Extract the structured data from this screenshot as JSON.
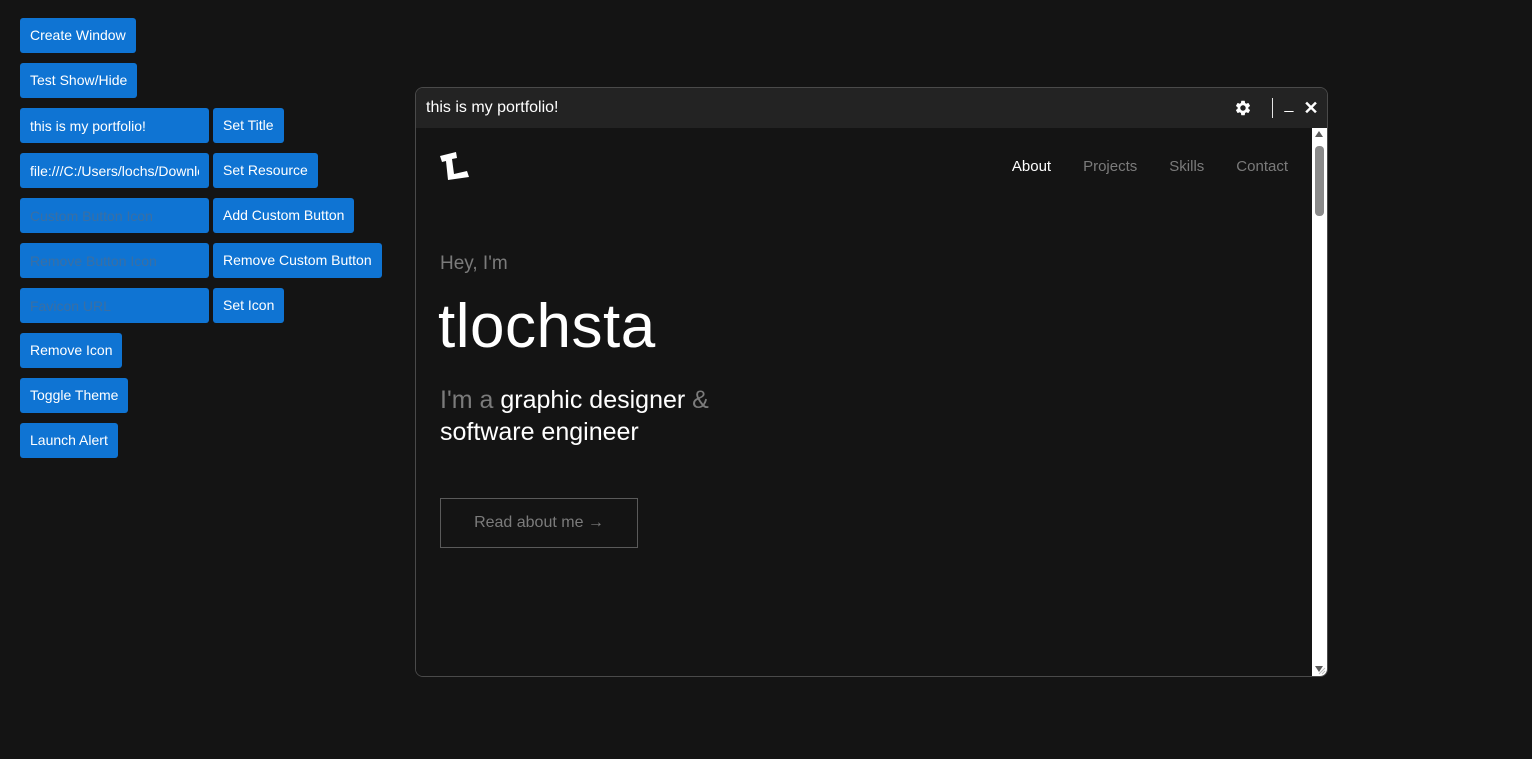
{
  "controls": {
    "create_window": "Create Window",
    "test_show_hide": "Test Show/Hide",
    "title_input_value": "this is my portfolio!",
    "set_title": "Set Title",
    "resource_input_value": "file:///C:/Users/lochs/Downloa",
    "set_resource": "Set Resource",
    "custom_button_icon_placeholder": "Custom Button Icon",
    "add_custom_button": "Add Custom Button",
    "remove_button_icon_placeholder": "Remove Button Icon",
    "remove_custom_button": "Remove Custom Button",
    "favicon_url_placeholder": "Favicon URL",
    "set_icon": "Set Icon",
    "remove_icon": "Remove Icon",
    "toggle_theme": "Toggle Theme",
    "launch_alert": "Launch Alert"
  },
  "window": {
    "title": "this is my portfolio!",
    "minimize_glyph": "_",
    "close_glyph": "✕",
    "icons": [
      "gear-icon",
      "minimize-icon",
      "close-icon"
    ]
  },
  "portfolio": {
    "nav": [
      "About",
      "Projects",
      "Skills",
      "Contact"
    ],
    "active_nav": "About",
    "greeting": "Hey, I'm",
    "name": "tlochsta",
    "tagline_prefix": "I'm a",
    "tagline_role1": "graphic designer",
    "tagline_amp": "&",
    "tagline_role2": "software engineer",
    "cta": "Read about me →"
  },
  "colors": {
    "page_bg": "#141414",
    "button_blue": "#0f74d3",
    "titlebar_bg": "#232323",
    "muted_text": "#7b7b7b"
  }
}
